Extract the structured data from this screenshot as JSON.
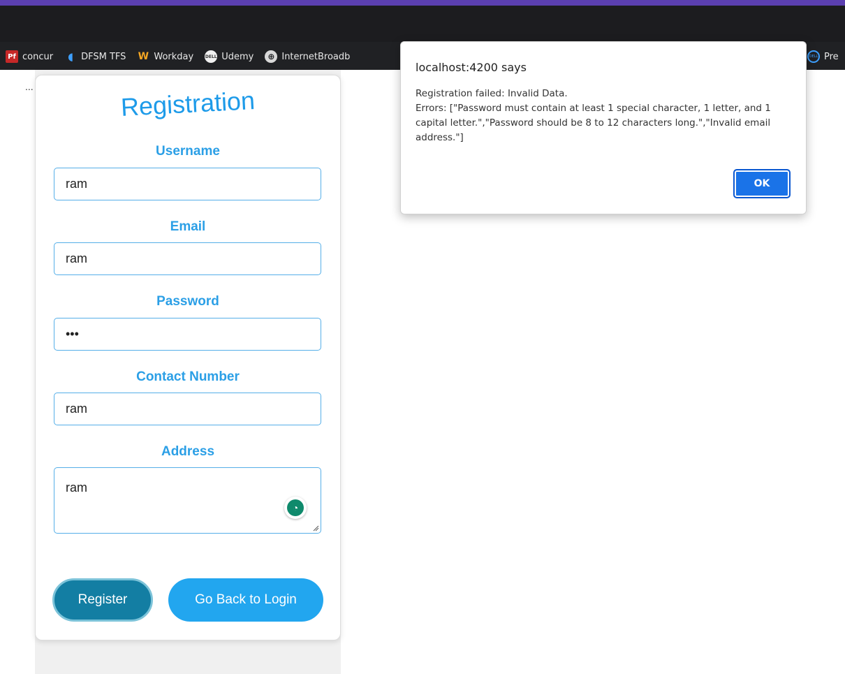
{
  "browser": {
    "bookmarks": [
      {
        "label": "concur",
        "icon": "pf-icon",
        "glyph": "Pf"
      },
      {
        "label": "DFSM TFS",
        "icon": "azure-devops-icon",
        "glyph": "◖"
      },
      {
        "label": "Workday",
        "icon": "workday-icon",
        "glyph": "W"
      },
      {
        "label": "Udemy",
        "icon": "dell-icon",
        "glyph": "DELL"
      },
      {
        "label": "InternetBroadb",
        "icon": "globe-icon",
        "glyph": "⊕"
      }
    ],
    "bookmark_overflow": {
      "label": "Pre",
      "icon": "dell-icon",
      "glyph": "DELL"
    },
    "ellipsis": "..."
  },
  "form": {
    "title": "Registration",
    "fields": [
      {
        "label": "Username",
        "value": "ram"
      },
      {
        "label": "Email",
        "value": "ram"
      },
      {
        "label": "Password",
        "value": "•••"
      },
      {
        "label": "Contact Number",
        "value": "ram"
      },
      {
        "label": "Address",
        "value": "ram"
      }
    ],
    "register_label": "Register",
    "back_label": "Go Back to Login"
  },
  "dialog": {
    "title": "localhost:4200 says",
    "line1": "Registration failed: Invalid Data.",
    "line2": "Errors: [\"Password must contain at least 1 special character, 1 letter, and 1 capital letter.\",\"Password should be 8 to 12 characters long.\",\"Invalid email address.\"]",
    "ok_label": "OK"
  },
  "colors": {
    "accent": "#1e9be9",
    "register_button": "#137ea3",
    "back_button": "#22a6ef",
    "ok_button": "#1a73e8"
  }
}
